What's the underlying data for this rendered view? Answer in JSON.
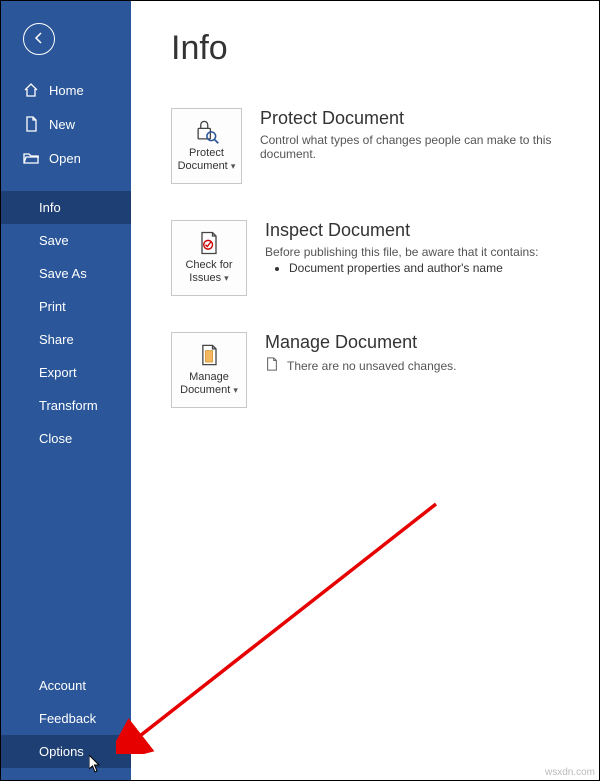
{
  "sidebar": {
    "nav": {
      "home": "Home",
      "new": "New",
      "open": "Open"
    },
    "items": [
      "Info",
      "Save",
      "Save As",
      "Print",
      "Share",
      "Export",
      "Transform",
      "Close"
    ],
    "selected": "Info",
    "bottom": [
      "Account",
      "Feedback",
      "Options"
    ],
    "hovered": "Options"
  },
  "page": {
    "title": "Info"
  },
  "protect": {
    "tile_label": "Protect Document",
    "heading": "Protect Document",
    "desc": "Control what types of changes people can make to this document."
  },
  "inspect": {
    "tile_label": "Check for Issues",
    "heading": "Inspect Document",
    "desc": "Before publishing this file, be aware that it contains:",
    "bullet1": "Document properties and author's name"
  },
  "manage": {
    "tile_label": "Manage Document",
    "heading": "Manage Document",
    "desc": "There are no unsaved changes."
  },
  "watermark": "wsxdn.com"
}
